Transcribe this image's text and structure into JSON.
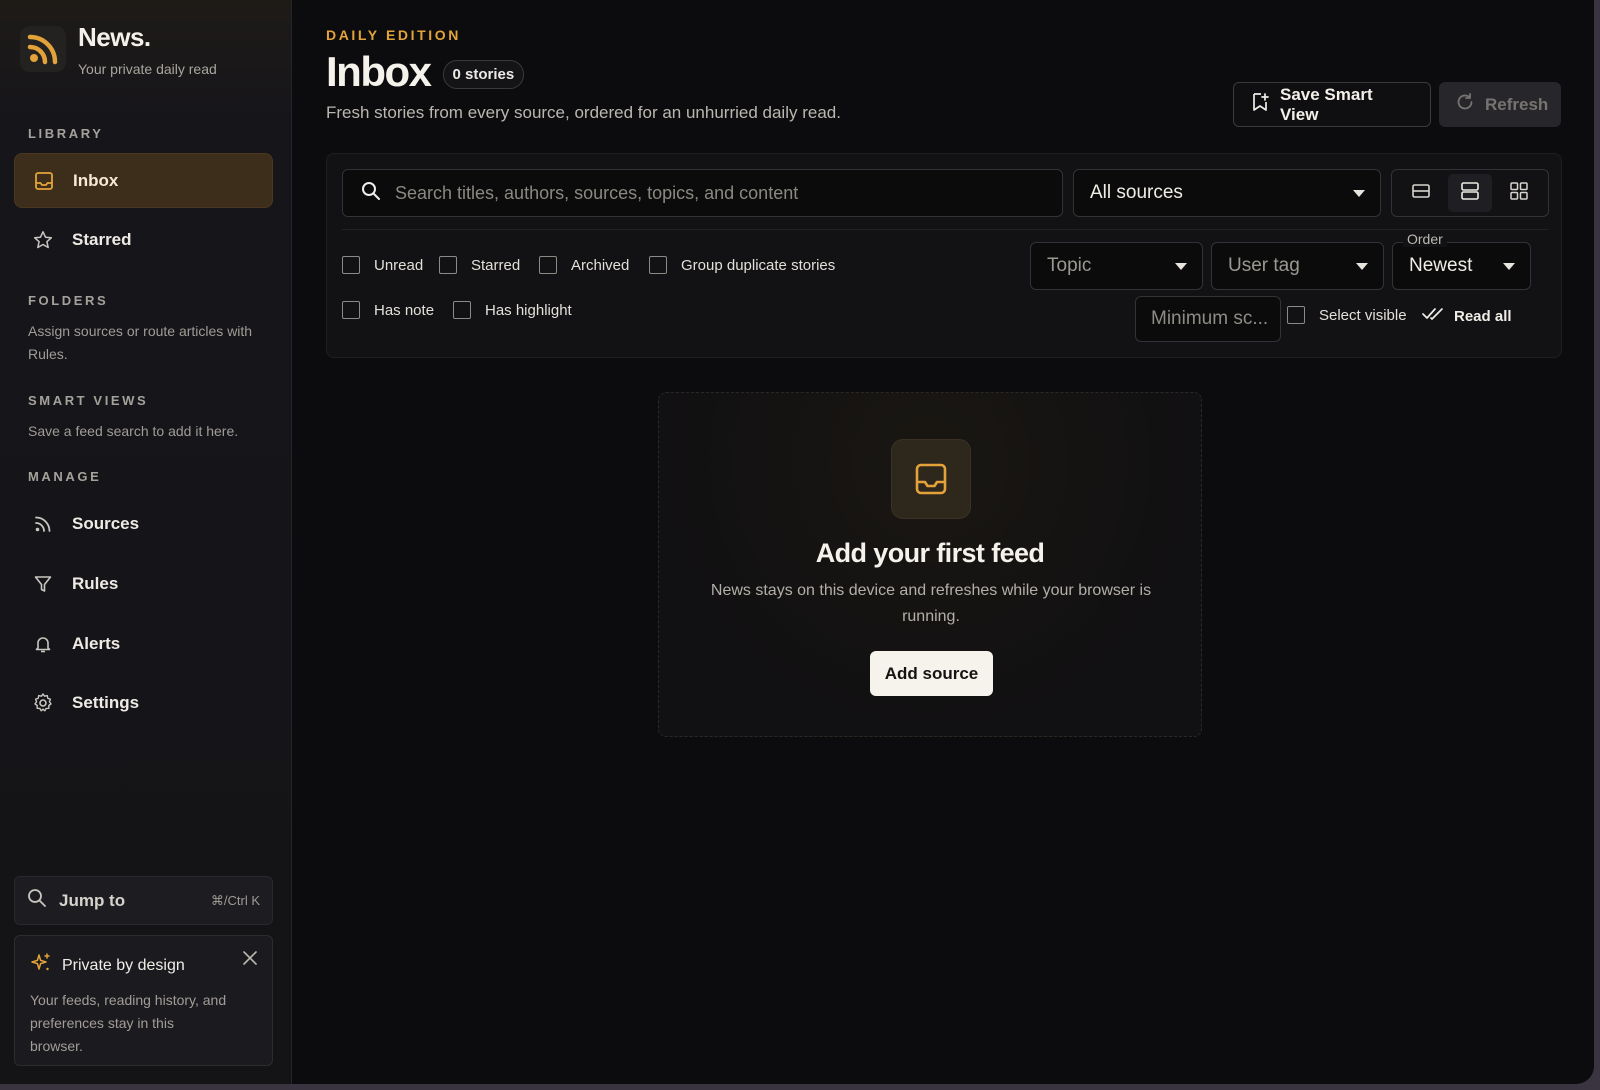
{
  "brand": {
    "name": "News.",
    "tagline": "Your private daily read",
    "accent": "#e3a33a"
  },
  "sidebar": {
    "library_label": "LIBRARY",
    "library_items": [
      {
        "label": "Inbox",
        "icon": "inbox-icon",
        "active": true
      },
      {
        "label": "Starred",
        "icon": "star-icon",
        "active": false
      }
    ],
    "folders_label": "FOLDERS",
    "folders_hint": "Assign sources or route articles with Rules.",
    "smart_views_label": "SMART VIEWS",
    "smart_views_hint": "Save a feed search to add it here.",
    "manage_label": "MANAGE",
    "manage_items": [
      {
        "label": "Sources",
        "icon": "rss-icon"
      },
      {
        "label": "Rules",
        "icon": "filter-icon"
      },
      {
        "label": "Alerts",
        "icon": "bell-icon"
      },
      {
        "label": "Settings",
        "icon": "gear-icon"
      }
    ],
    "jump": {
      "label": "Jump to",
      "shortcut": "⌘/Ctrl K"
    },
    "private_card": {
      "title": "Private by design",
      "body": "Your feeds, reading history, and preferences stay in this browser."
    }
  },
  "header": {
    "eyebrow": "DAILY EDITION",
    "title": "Inbox",
    "count_badge": "0 stories",
    "subtitle": "Fresh stories from every source, ordered for an unhurried daily read.",
    "save_view_label": "Save Smart View",
    "refresh_label": "Refresh"
  },
  "filters": {
    "search_placeholder": "Search titles, authors, sources, topics, and content",
    "sources_selected": "All sources",
    "views": [
      "compact-view-icon",
      "list-view-icon",
      "grid-view-icon"
    ],
    "checkboxes_row1": [
      "Unread",
      "Starred",
      "Archived",
      "Group duplicate stories"
    ],
    "checkboxes_row2": [
      "Has note",
      "Has highlight"
    ],
    "topic_placeholder": "Topic",
    "user_tag_placeholder": "User tag",
    "order_label": "Order",
    "order_selected": "Newest",
    "min_score_placeholder": "Minimum sc...",
    "select_visible_label": "Select visible",
    "read_all_label": "Read all"
  },
  "empty_state": {
    "title": "Add your first feed",
    "description": "News stays on this device and refreshes while your browser is running.",
    "button_label": "Add source"
  }
}
